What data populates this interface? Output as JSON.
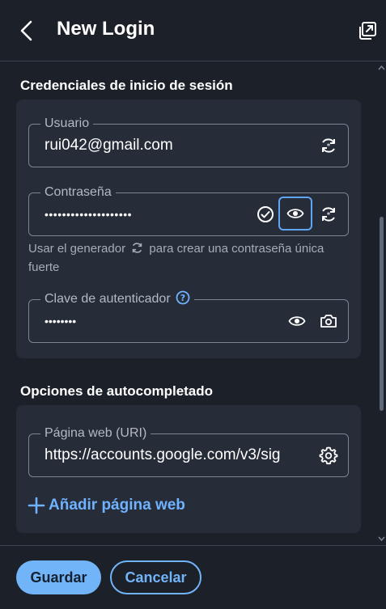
{
  "header": {
    "title": "New Login",
    "back_icon": "chevron-left-icon",
    "popout_icon": "popout-icon"
  },
  "credentials": {
    "section_title": "Credenciales de inicio de sesión",
    "username": {
      "label": "Usuario",
      "value": "rui042@gmail.com"
    },
    "password": {
      "label": "Contraseña",
      "value": "••••••••••••••••••••"
    },
    "generator_hint_before": "Usar el generador",
    "generator_hint_after": "para crear una contraseña única fuerte",
    "totp": {
      "label": "Clave de autenticador",
      "value": "••••••••"
    }
  },
  "autofill": {
    "section_title": "Opciones de autocompletado",
    "uri": {
      "label": "Página web (URI)",
      "value": "https://accounts.google.com/v3/sig"
    },
    "add_label": "Añadir página web"
  },
  "footer": {
    "save_label": "Guardar",
    "cancel_label": "Cancelar"
  },
  "colors": {
    "accent": "#72b4f8",
    "background": "#1b2029",
    "card": "#262c38"
  }
}
